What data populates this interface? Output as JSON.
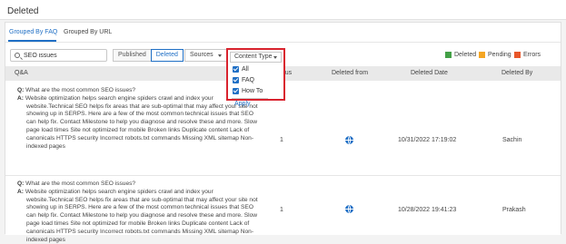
{
  "page": {
    "title": "Deleted"
  },
  "tabs": [
    {
      "label": "Grouped By FAQ"
    },
    {
      "label": "Grouped By URL"
    }
  ],
  "toolbar": {
    "search_value": "SEO issues",
    "status_filter": [
      {
        "label": "Published"
      },
      {
        "label": "Deleted"
      }
    ],
    "sources_label": "Sources",
    "content_type_label": "Content Type"
  },
  "legend": [
    {
      "label": "Deleted",
      "color": "#43a047"
    },
    {
      "label": "Pending",
      "color": "#f5a623"
    },
    {
      "label": "Errors",
      "color": "#e8572a"
    }
  ],
  "table": {
    "headers": {
      "qa": "Q&A",
      "status": "tatus",
      "deleted_from": "Deleted from",
      "deleted_date": "Deleted Date",
      "deleted_by": "Deleted By"
    },
    "rows": [
      {
        "q_prefix": "Q:",
        "question": "What are the most common SEO issues?",
        "a_prefix": "A:",
        "answer_line1": "Website optimization helps search engine spiders crawl and index your",
        "answer_rest": "website.Technical SEO helps fix areas that are sub-optimal that may affect your site not showing up in SERPS. Here are a few of the most common technical issues that SEO can help fix. Contact Milestone to help you diagnose and resolve these and more.  Slow page load times  Site not optimized for mobile  Broken links  Duplicate content  Lack of canonicals  HTTPS security  Incorrect robots.txt commands  Missing XML sitemap  Non-indexed pages",
        "count": "1",
        "deleted_date": "10/31/2022 17:19:02",
        "deleted_by": "Sachin"
      },
      {
        "q_prefix": "Q:",
        "question": "What are the most common SEO issues?",
        "a_prefix": "A:",
        "answer_line1": "Website optimization helps search engine spiders crawl and index your",
        "answer_rest": "website.Technical SEO helps fix areas that are sub-optimal that may affect your site not showing up in SERPS. Here are a few of the most common technical issues that SEO can help fix. Contact Milestone to help you diagnose and resolve these and more.  Slow page load times  Site not optimized for mobile  Broken links  Duplicate content  Lack of canonicals  HTTPS security  Incorrect robots.txt commands  Missing XML sitemap  Non-indexed pages",
        "count": "1",
        "deleted_date": "10/28/2022 19:41:23",
        "deleted_by": "Prakash"
      }
    ]
  },
  "content_type_menu": {
    "label": "Content Type",
    "options": [
      {
        "label": "All"
      },
      {
        "label": "FAQ"
      },
      {
        "label": "How To"
      }
    ],
    "apply_label": "Apply"
  }
}
